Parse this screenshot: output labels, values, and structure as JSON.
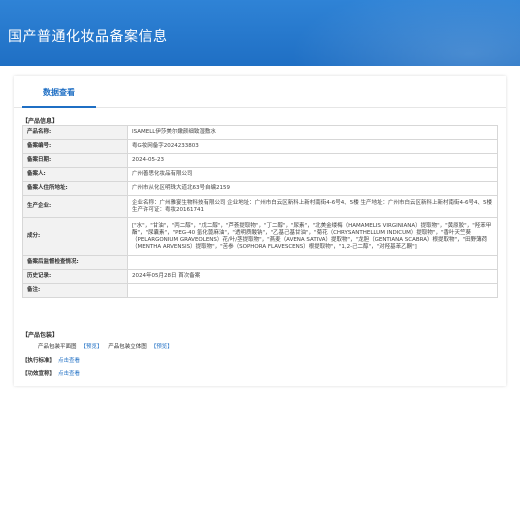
{
  "banner": {
    "title": "国产普通化妆品备案信息"
  },
  "tabs": [
    {
      "label": "数据查看"
    }
  ],
  "section_product_info": "【产品信息】",
  "info_rows": [
    {
      "label": "产品名称:",
      "value": "ISAMELL伊莎美尔嫩颜细致湿敷水"
    },
    {
      "label": "备案编号:",
      "value": "粤G妆网备字2024233803"
    },
    {
      "label": "备案日期:",
      "value": "2024-05-23"
    },
    {
      "label": "备案人:",
      "value": "广州善思化妆品有限公司"
    },
    {
      "label": "备案人住所地址:",
      "value": "广州市从化区明珠大道北63号自编2159"
    },
    {
      "label": "生产企业:",
      "value": "企业名称：广州雅宴生物科技有限公司 企业地址：广州市白云区新科上新村南街4-6号4、5楼 生产地址：广州市白云区新科上新村南街4-6号4、5楼 生产许可证：粤妆20161741"
    },
    {
      "label": "成分:",
      "value": "[\"水\"，\"甘油\"，\"丙二醇\"，\"戊二醇\"，\"芦荟提取物\"，\"丁二醇\"，\"尿素\"，\"北美金缕梅（HAMAMELIS VIRGINIANA）提取物\"，\"黄原胶\"，\"羟苯甲酯\"，\"尿囊素\"，\"PEG-40 氢化蓖麻油\"，\"透明质酸钠\"，\"乙基己基甘油\"，\"菊花（CHRYSANTHELLUM INDICUM）提取物\"，\"香叶天竺葵（PELARGONIUM GRAVEOLENS）花/叶/茎提取物\"，\"燕麦（AVENA SATIVA）提取物\"，\"龙胆（GENTIANA SCABRA）根提取物\"，\"田野薄荷（MENTHA ARVENSIS）提取物\"，\"苦参（SOPHORA FLAVESCENS）根提取物\"，\"1,2-己二醇\"，\"对羟基苯乙酮\"]"
    },
    {
      "label": "备案后监督检查情况:",
      "value": ""
    },
    {
      "label": "历史记录:",
      "value": "2024年05月28日 首次备案"
    },
    {
      "label": "备注:",
      "value": ""
    }
  ],
  "section_packaging": "【产品包装】",
  "packaging": {
    "flat_label": "产品包装平面图",
    "flat_link": "【预览】",
    "solid_label": "产品包装立体图",
    "solid_link": "【预览】"
  },
  "exec_standard": {
    "label": "【执行标准】",
    "link": "点击查看"
  },
  "efficacy": {
    "label": "【功效宣称】",
    "link": "点击查看"
  }
}
